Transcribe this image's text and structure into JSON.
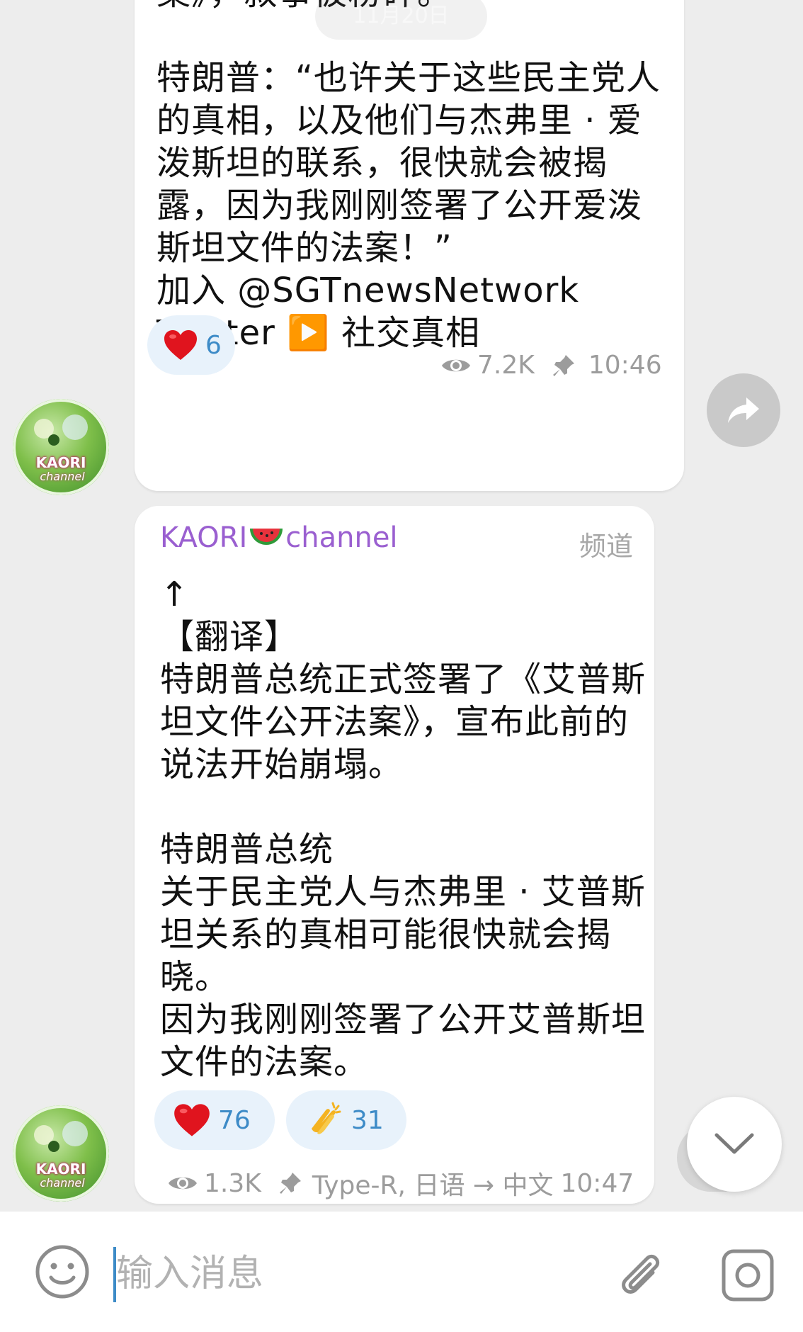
{
  "date_pill": "11月20日",
  "message1": {
    "text": "案》，叙事被粉碎。\n\n特朗普：“也许关于这些民主党人的真相，以及他们与杰弗里 · 爱泼斯坦的联系，很快就会被揭露，因为我刚刚签署了公开爱泼斯坦文件的法案！”\n加入 @SGTnewsNetwork\nTwitter ▶️ 社交真相",
    "reactions": [
      {
        "emoji": "heart",
        "count": "6"
      }
    ],
    "views": "7.2K",
    "time": "10:46"
  },
  "message2": {
    "sender": "KAORI",
    "sender_suffix": "channel",
    "channel_tag": "频道",
    "text": "↑\n【翻译】\n特朗普总统正式签署了《艾普斯坦文件公开法案》，宣布此前的说法开始崩塌。\n\n特朗普总统\n关于民主党人与杰弗里 · 艾普斯坦关系的真相可能很快就会揭晓。\n因为我刚刚签署了公开艾普斯坦文件的法案。",
    "reactions": [
      {
        "emoji": "heart",
        "count": "76"
      },
      {
        "emoji": "clap",
        "count": "31"
      }
    ],
    "views": "1.3K",
    "author": "Type-R, 日语 → 中文",
    "time": "10:47"
  },
  "avatar": {
    "line1": "KAORI",
    "line2": "channel"
  },
  "composer": {
    "placeholder": "输入消息"
  },
  "colors": {
    "background": "#ededed",
    "bubble": "#ffffff",
    "accent": "#3d8bc7",
    "sender": "#9a5fd0",
    "meta": "#9c9c9c"
  }
}
